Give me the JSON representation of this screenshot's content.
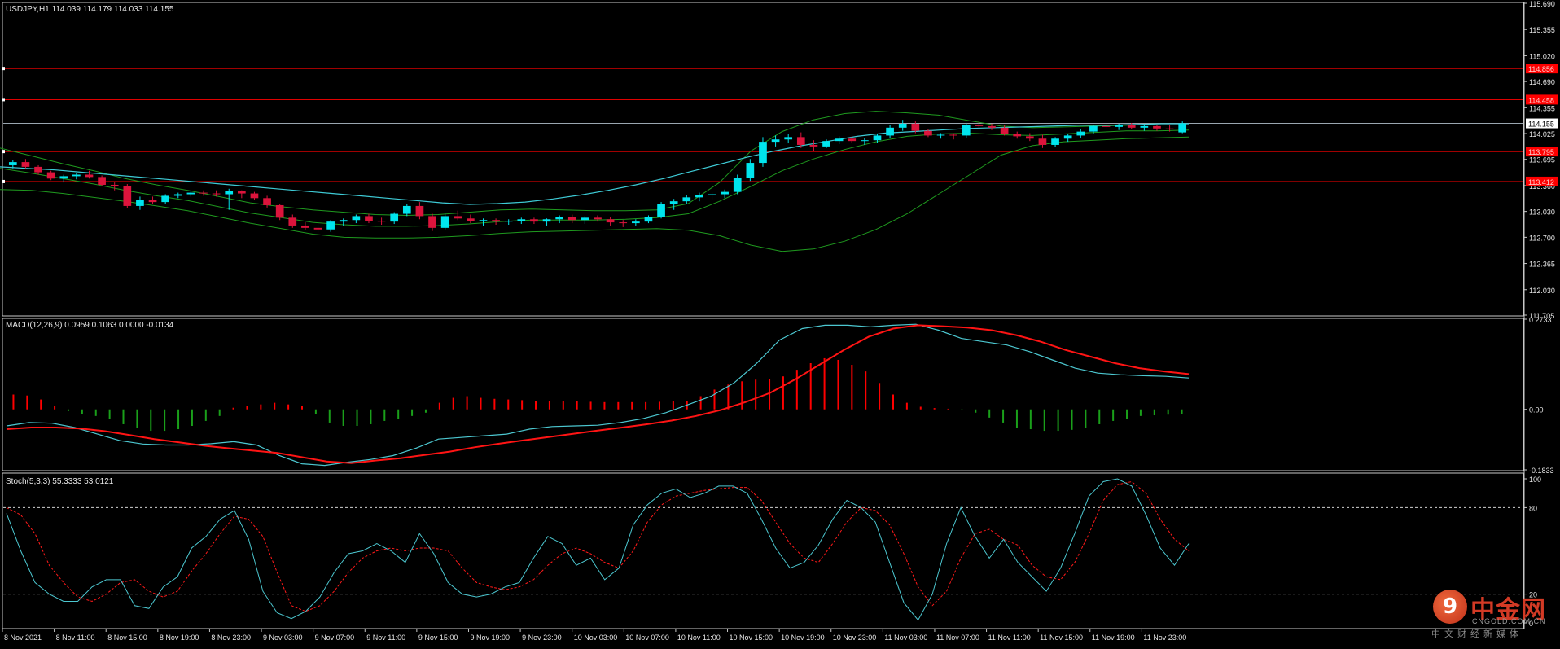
{
  "colors": {
    "background": "#000000",
    "grid_border": "#c8c8c8",
    "text": "#e6e6e6",
    "bull": "#00e5ee",
    "bear": "#dc143c",
    "hline": "#ff0000",
    "ma": "#3ecbd6",
    "bands": "#1f9a1f",
    "macd_hist_pos": "#ff0000",
    "macd_hist_neg": "#1aa01a",
    "macd_main": "#4cc7d0",
    "macd_signal": "#ff1414",
    "stoch_main": "#4cc7d0",
    "stoch_signal": "#ff1a1a",
    "price_marker": "#ffffff"
  },
  "main_panel": {
    "header": "USDJPY,H1  114.039 114.179 114.033 114.155",
    "price_labels": [
      "115.690",
      "115.355",
      "115.020",
      "114.690",
      "114.355",
      "114.155",
      "114.025",
      "113.695",
      "113.360",
      "113.030",
      "112.700",
      "112.365",
      "112.030",
      "111.705"
    ],
    "level_tags": [
      "114.856",
      "114.458",
      "113.795",
      "113.412"
    ],
    "current_price": "114.155"
  },
  "macd_panel": {
    "header": "MACD(12,26,9) 0.0959 0.1063 0.0000 -0.0134",
    "labels": [
      "0.2733",
      "0.00",
      "-0.1833"
    ]
  },
  "stoch_panel": {
    "header": "Stoch(5,3,3) 55.3333 53.0121",
    "labels": [
      "100",
      "80",
      "20",
      "0"
    ]
  },
  "time_axis": [
    "8 Nov 2021",
    "8 Nov 11:00",
    "8 Nov 15:00",
    "8 Nov 19:00",
    "8 Nov 23:00",
    "9 Nov 03:00",
    "9 Nov 07:00",
    "9 Nov 11:00",
    "9 Nov 15:00",
    "9 Nov 19:00",
    "9 Nov 23:00",
    "10 Nov 03:00",
    "10 Nov 07:00",
    "10 Nov 11:00",
    "10 Nov 15:00",
    "10 Nov 19:00",
    "10 Nov 23:00",
    "11 Nov 03:00",
    "11 Nov 07:00",
    "11 Nov 11:00",
    "11 Nov 15:00",
    "11 Nov 19:00",
    "11 Nov 23:00"
  ],
  "watermark": {
    "logo": "9",
    "name": "中金网",
    "url": "CNGOLD.COM.CN",
    "sub": "中文财经新媒体"
  },
  "chart_data": [
    {
      "type": "candlestick",
      "symbol": "USDJPY",
      "timeframe": "H1",
      "ylim": [
        111.705,
        115.69
      ],
      "horizontal_levels": [
        114.856,
        114.458,
        113.795,
        113.412
      ],
      "current_price_line": 114.155,
      "ohlc": [
        [
          113.62,
          113.69,
          113.58,
          113.66
        ],
        [
          113.66,
          113.7,
          113.58,
          113.6
        ],
        [
          113.6,
          113.62,
          113.5,
          113.53
        ],
        [
          113.53,
          113.55,
          113.43,
          113.45
        ],
        [
          113.45,
          113.5,
          113.4,
          113.48
        ],
        [
          113.48,
          113.52,
          113.44,
          113.5
        ],
        [
          113.5,
          113.55,
          113.45,
          113.47
        ],
        [
          113.47,
          113.49,
          113.35,
          113.37
        ],
        [
          113.37,
          113.4,
          113.3,
          113.35
        ],
        [
          113.35,
          113.38,
          113.07,
          113.1
        ],
        [
          113.1,
          113.22,
          113.05,
          113.18
        ],
        [
          113.18,
          113.22,
          113.12,
          113.15
        ],
        [
          113.15,
          113.25,
          113.12,
          113.23
        ],
        [
          113.23,
          113.27,
          113.2,
          113.25
        ],
        [
          113.25,
          113.29,
          113.22,
          113.27
        ],
        [
          113.27,
          113.3,
          113.23,
          113.26
        ],
        [
          113.26,
          113.3,
          113.22,
          113.25
        ],
        [
          113.25,
          113.32,
          113.05,
          113.29
        ],
        [
          113.29,
          113.3,
          113.2,
          113.26
        ],
        [
          113.26,
          113.28,
          113.18,
          113.2
        ],
        [
          113.2,
          113.23,
          113.08,
          113.11
        ],
        [
          113.11,
          113.13,
          112.92,
          112.95
        ],
        [
          112.95,
          112.99,
          112.82,
          112.85
        ],
        [
          112.85,
          112.89,
          112.79,
          112.82
        ],
        [
          112.82,
          112.87,
          112.76,
          112.8
        ],
        [
          112.8,
          112.92,
          112.77,
          112.9
        ],
        [
          112.9,
          112.94,
          112.84,
          112.92
        ],
        [
          112.92,
          112.99,
          112.88,
          112.97
        ],
        [
          112.97,
          113.0,
          112.88,
          112.91
        ],
        [
          112.91,
          112.95,
          112.86,
          112.9
        ],
        [
          112.9,
          113.02,
          112.87,
          113.0
        ],
        [
          113.0,
          113.12,
          112.97,
          113.1
        ],
        [
          113.1,
          113.15,
          112.93,
          112.97
        ],
        [
          112.97,
          113.0,
          112.78,
          112.82
        ],
        [
          112.82,
          113.0,
          112.8,
          112.97
        ],
        [
          112.97,
          113.04,
          112.92,
          112.94
        ],
        [
          112.94,
          112.99,
          112.88,
          112.91
        ],
        [
          112.91,
          112.94,
          112.85,
          112.92
        ],
        [
          112.92,
          112.94,
          112.86,
          112.9
        ],
        [
          112.9,
          112.93,
          112.86,
          112.91
        ],
        [
          112.91,
          112.95,
          112.87,
          112.93
        ],
        [
          112.93,
          112.95,
          112.87,
          112.9
        ],
        [
          112.9,
          112.94,
          112.85,
          112.93
        ],
        [
          112.93,
          112.98,
          112.88,
          112.96
        ],
        [
          112.96,
          112.99,
          112.88,
          112.92
        ],
        [
          112.92,
          112.97,
          112.87,
          112.95
        ],
        [
          112.95,
          112.98,
          112.9,
          112.93
        ],
        [
          112.93,
          112.96,
          112.85,
          112.89
        ],
        [
          112.89,
          112.92,
          112.83,
          112.88
        ],
        [
          112.88,
          112.93,
          112.85,
          112.9
        ],
        [
          112.9,
          112.98,
          112.88,
          112.96
        ],
        [
          112.96,
          113.15,
          112.94,
          113.12
        ],
        [
          113.12,
          113.19,
          113.05,
          113.16
        ],
        [
          113.16,
          113.24,
          113.12,
          113.21
        ],
        [
          113.21,
          113.27,
          113.16,
          113.24
        ],
        [
          113.24,
          113.28,
          113.18,
          113.25
        ],
        [
          113.25,
          113.31,
          113.2,
          113.28
        ],
        [
          113.28,
          113.5,
          113.25,
          113.46
        ],
        [
          113.46,
          113.7,
          113.42,
          113.65
        ],
        [
          113.65,
          113.98,
          113.6,
          113.92
        ],
        [
          113.92,
          114.0,
          113.86,
          113.95
        ],
        [
          113.95,
          114.02,
          113.9,
          113.98
        ],
        [
          113.98,
          114.04,
          113.84,
          113.88
        ],
        [
          113.88,
          113.94,
          113.8,
          113.86
        ],
        [
          113.86,
          113.95,
          113.84,
          113.93
        ],
        [
          113.93,
          113.99,
          113.89,
          113.96
        ],
        [
          113.96,
          113.99,
          113.9,
          113.93
        ],
        [
          113.93,
          113.97,
          113.88,
          113.94
        ],
        [
          113.94,
          114.02,
          113.91,
          114.0
        ],
        [
          114.0,
          114.13,
          113.97,
          114.1
        ],
        [
          114.1,
          114.2,
          114.06,
          114.15
        ],
        [
          114.15,
          114.18,
          114.03,
          114.06
        ],
        [
          114.06,
          114.08,
          113.98,
          114.0
        ],
        [
          114.0,
          114.03,
          113.96,
          114.01
        ],
        [
          114.01,
          114.03,
          113.95,
          114.0
        ],
        [
          114.0,
          114.16,
          113.97,
          114.14
        ],
        [
          114.14,
          114.18,
          114.08,
          114.12
        ],
        [
          114.12,
          114.15,
          114.07,
          114.1
        ],
        [
          114.1,
          114.13,
          114.0,
          114.02
        ],
        [
          114.02,
          114.05,
          113.96,
          113.99
        ],
        [
          113.99,
          114.03,
          113.93,
          113.96
        ],
        [
          113.96,
          114.01,
          113.84,
          113.88
        ],
        [
          113.88,
          113.98,
          113.85,
          113.96
        ],
        [
          113.96,
          114.02,
          113.92,
          114.0
        ],
        [
          114.0,
          114.08,
          113.97,
          114.05
        ],
        [
          114.05,
          114.14,
          114.02,
          114.12
        ],
        [
          114.12,
          114.15,
          114.08,
          114.11
        ],
        [
          114.11,
          114.15,
          114.07,
          114.13
        ],
        [
          114.13,
          114.16,
          114.08,
          114.1
        ],
        [
          114.1,
          114.14,
          114.06,
          114.12
        ],
        [
          114.12,
          114.14,
          114.06,
          114.09
        ],
        [
          114.09,
          114.13,
          114.05,
          114.08
        ],
        [
          114.04,
          114.18,
          114.03,
          114.155
        ]
      ],
      "moving_average": [
        113.6,
        113.58,
        113.56,
        113.53,
        113.5,
        113.47,
        113.44,
        113.41,
        113.38,
        113.35,
        113.32,
        113.29,
        113.26,
        113.23,
        113.2,
        113.17,
        113.14,
        113.12,
        113.13,
        113.15,
        113.19,
        113.24,
        113.3,
        113.37,
        113.45,
        113.54,
        113.63,
        113.72,
        113.8,
        113.87,
        113.93,
        113.99,
        114.03,
        114.05,
        114.07,
        114.09,
        114.1,
        114.11,
        114.12,
        114.13,
        114.13,
        114.14,
        114.15,
        114.15
      ],
      "band_upper": [
        113.84,
        113.74,
        113.64,
        113.55,
        113.45,
        113.37,
        113.3,
        113.22,
        113.14,
        113.09,
        113.05,
        113.02,
        112.99,
        112.98,
        112.99,
        113.02,
        113.05,
        113.06,
        113.05,
        113.04,
        113.04,
        113.05,
        113.13,
        113.4,
        113.8,
        114.05,
        114.2,
        114.28,
        114.31,
        114.29,
        114.26,
        114.19,
        114.12,
        114.1,
        114.11,
        114.12,
        114.13,
        114.15,
        114.15
      ],
      "band_lower": [
        113.31,
        113.3,
        113.26,
        113.21,
        113.16,
        113.1,
        113.04,
        112.96,
        112.88,
        112.81,
        112.74,
        112.7,
        112.69,
        112.69,
        112.7,
        112.72,
        112.75,
        112.77,
        112.78,
        112.79,
        112.8,
        112.81,
        112.79,
        112.72,
        112.6,
        112.52,
        112.55,
        112.65,
        112.8,
        113.0,
        113.25,
        113.5,
        113.75,
        113.87,
        113.92,
        113.94,
        113.96,
        113.97,
        113.98
      ],
      "band_middle": [
        113.58,
        113.52,
        113.45,
        113.38,
        113.3,
        113.23,
        113.17,
        113.09,
        113.01,
        112.95,
        112.89,
        112.86,
        112.84,
        112.84,
        112.85,
        112.87,
        112.9,
        112.92,
        112.92,
        112.92,
        112.93,
        112.95,
        113.0,
        113.16,
        113.35,
        113.55,
        113.7,
        113.82,
        113.92,
        113.99,
        114.02,
        114.03,
        114.01,
        114.0,
        114.02,
        114.04,
        114.06,
        114.06,
        114.07
      ]
    },
    {
      "type": "bar",
      "title": "MACD(12,26,9)",
      "ylim": [
        -0.1833,
        0.2733
      ],
      "histogram": [
        0.045,
        0.042,
        0.03,
        0.01,
        -0.005,
        -0.015,
        -0.02,
        -0.03,
        -0.045,
        -0.055,
        -0.065,
        -0.065,
        -0.06,
        -0.05,
        -0.035,
        -0.02,
        0.005,
        0.01,
        0.015,
        0.02,
        0.015,
        0.01,
        -0.015,
        -0.04,
        -0.05,
        -0.05,
        -0.045,
        -0.035,
        -0.03,
        -0.02,
        -0.01,
        0.02,
        0.035,
        0.04,
        0.035,
        0.032,
        0.03,
        0.028,
        0.026,
        0.025,
        0.024,
        0.024,
        0.023,
        0.022,
        0.022,
        0.022,
        0.022,
        0.023,
        0.024,
        0.025,
        0.04,
        0.06,
        0.075,
        0.085,
        0.09,
        0.092,
        0.1,
        0.12,
        0.14,
        0.155,
        0.15,
        0.135,
        0.115,
        0.08,
        0.045,
        0.02,
        0.008,
        0.004,
        0.002,
        -0.002,
        -0.01,
        -0.025,
        -0.04,
        -0.055,
        -0.06,
        -0.065,
        -0.065,
        -0.062,
        -0.055,
        -0.045,
        -0.035,
        -0.028,
        -0.02,
        -0.018,
        -0.016,
        -0.013
      ],
      "macd_main": [
        -0.05,
        -0.04,
        -0.042,
        -0.055,
        -0.075,
        -0.095,
        -0.105,
        -0.108,
        -0.108,
        -0.104,
        -0.098,
        -0.108,
        -0.14,
        -0.165,
        -0.17,
        -0.16,
        -0.152,
        -0.14,
        -0.118,
        -0.09,
        -0.085,
        -0.08,
        -0.075,
        -0.06,
        -0.052,
        -0.05,
        -0.048,
        -0.04,
        -0.028,
        -0.01,
        0.015,
        0.04,
        0.08,
        0.14,
        0.21,
        0.245,
        0.255,
        0.255,
        0.25,
        0.255,
        0.258,
        0.24,
        0.215,
        0.205,
        0.195,
        0.175,
        0.15,
        0.125,
        0.11,
        0.105,
        0.102,
        0.1,
        0.095
      ],
      "macd_signal": [
        -0.06,
        -0.055,
        -0.055,
        -0.058,
        -0.066,
        -0.078,
        -0.09,
        -0.1,
        -0.11,
        -0.118,
        -0.125,
        -0.132,
        -0.145,
        -0.158,
        -0.163,
        -0.155,
        -0.148,
        -0.138,
        -0.128,
        -0.115,
        -0.104,
        -0.094,
        -0.084,
        -0.074,
        -0.064,
        -0.055,
        -0.045,
        -0.034,
        -0.02,
        -0.002,
        0.022,
        0.05,
        0.09,
        0.135,
        0.18,
        0.22,
        0.245,
        0.255,
        0.252,
        0.248,
        0.24,
        0.225,
        0.205,
        0.18,
        0.16,
        0.14,
        0.125,
        0.115,
        0.107
      ]
    },
    {
      "type": "line",
      "title": "Stoch(5,3,3)",
      "ylim": [
        0,
        100
      ],
      "levels": [
        80,
        20
      ],
      "stoch_main": [
        76,
        50,
        28,
        20,
        15,
        15,
        25,
        30,
        30,
        12,
        10,
        25,
        32,
        52,
        60,
        72,
        78,
        58,
        22,
        7,
        3,
        8,
        18,
        35,
        48,
        50,
        55,
        50,
        42,
        62,
        48,
        28,
        20,
        18,
        20,
        25,
        28,
        45,
        60,
        55,
        40,
        45,
        30,
        38,
        68,
        82,
        90,
        93,
        87,
        90,
        95,
        95,
        90,
        72,
        52,
        38,
        42,
        54,
        72,
        85,
        80,
        70,
        42,
        14,
        2,
        20,
        55,
        80,
        60,
        45,
        58,
        42,
        32,
        22,
        38,
        62,
        88,
        98,
        100,
        95,
        75,
        52,
        40,
        55
      ],
      "stoch_signal": [
        80,
        75,
        62,
        40,
        28,
        18,
        15,
        20,
        28,
        30,
        22,
        18,
        22,
        36,
        48,
        62,
        74,
        72,
        60,
        35,
        12,
        8,
        12,
        22,
        35,
        45,
        50,
        52,
        50,
        52,
        52,
        50,
        38,
        28,
        25,
        23,
        25,
        30,
        40,
        48,
        52,
        48,
        42,
        38,
        50,
        70,
        82,
        88,
        90,
        92,
        93,
        94,
        94,
        85,
        70,
        55,
        45,
        42,
        55,
        70,
        80,
        78,
        68,
        48,
        25,
        12,
        22,
        45,
        62,
        65,
        58,
        54,
        40,
        32,
        30,
        42,
        62,
        85,
        96,
        98,
        90,
        72,
        58,
        50
      ]
    }
  ]
}
